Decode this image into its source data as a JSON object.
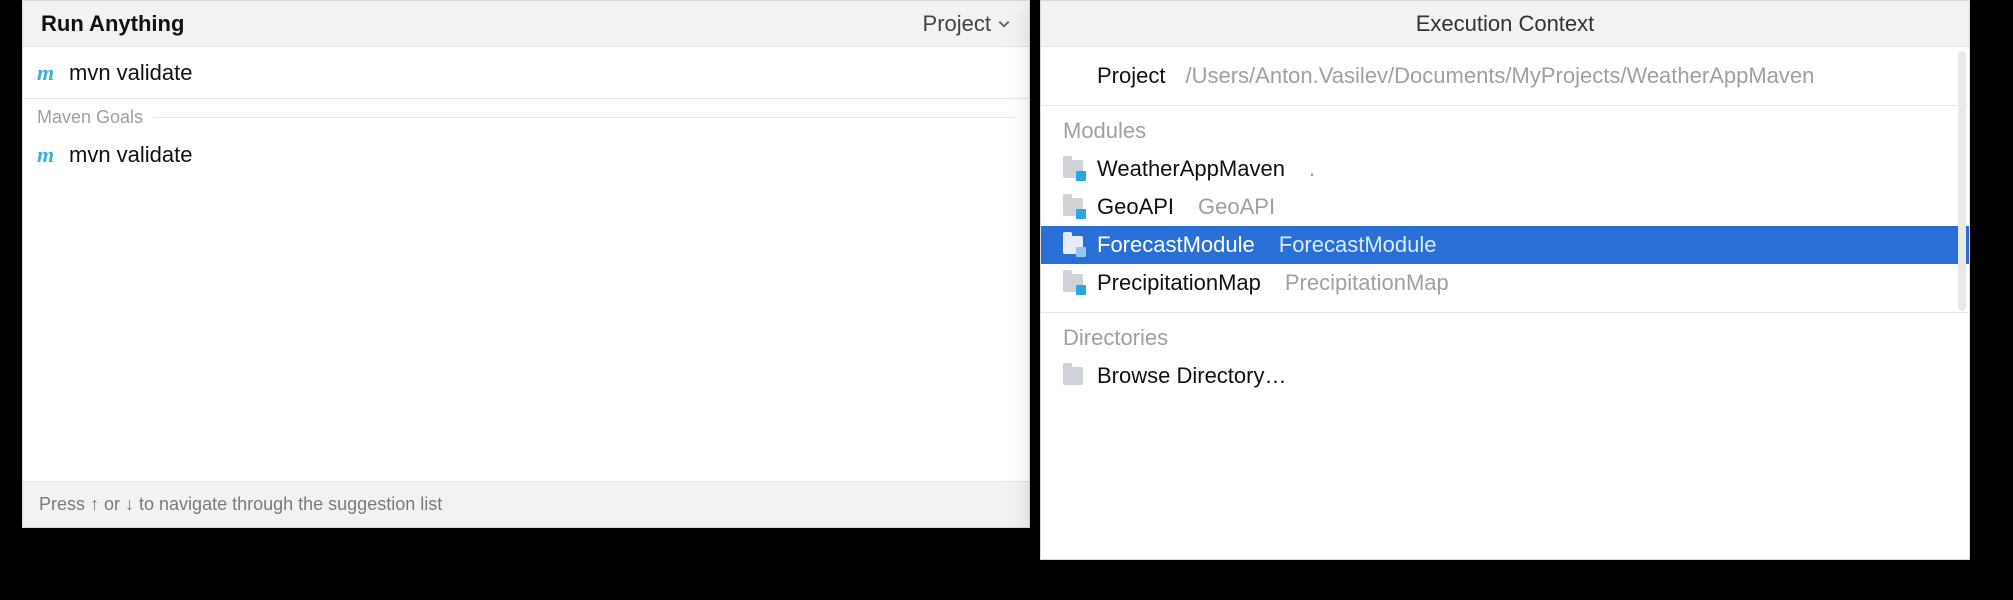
{
  "run": {
    "title": "Run Anything",
    "project_dropdown_label": "Project",
    "input_value": "mvn validate",
    "section_label": "Maven Goals",
    "suggestion": "mvn validate",
    "footer": "Press ↑ or ↓ to navigate through the suggestion list"
  },
  "context": {
    "title": "Execution Context",
    "project_label": "Project",
    "project_path": "/Users/Anton.Vasilev/Documents/MyProjects/WeatherAppMaven",
    "modules_label": "Modules",
    "modules": [
      {
        "name": "WeatherAppMaven",
        "sub": "."
      },
      {
        "name": "GeoAPI",
        "sub": "GeoAPI"
      },
      {
        "name": "ForecastModule",
        "sub": "ForecastModule",
        "selected": true
      },
      {
        "name": "PrecipitationMap",
        "sub": "PrecipitationMap"
      }
    ],
    "directories_label": "Directories",
    "browse_label": "Browse Directory…"
  },
  "colors": {
    "accent": "#2a6fd6",
    "maven_m": "#39b1df"
  }
}
